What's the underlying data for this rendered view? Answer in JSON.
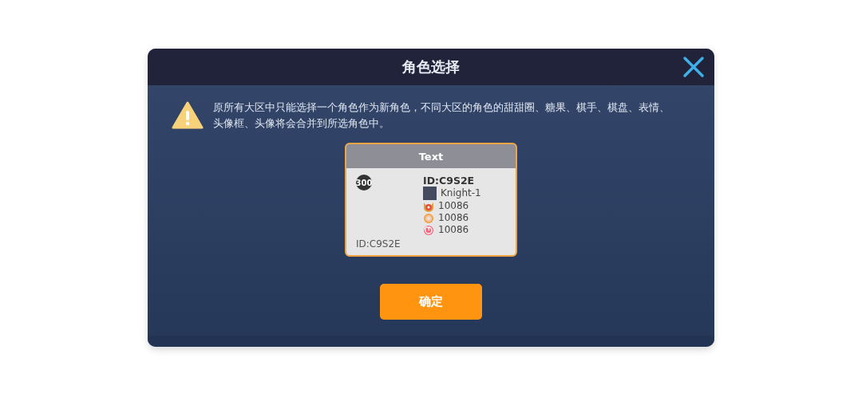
{
  "dialog": {
    "title": "角色选择"
  },
  "notice": "原所有大区中只能选择一个角色作为新角色，不同大区的角色的甜甜圈、糖果、棋手、棋盘、表情、头像框、头像将会合并到所选角色中。",
  "card": {
    "header": "Text",
    "level_badge": "300",
    "id_left": "ID:C9S2E",
    "id": "ID:C9S2E",
    "name": "Knight-1",
    "stats": [
      {
        "kind": "medal",
        "value": "10086"
      },
      {
        "kind": "donut",
        "value": "10086"
      },
      {
        "kind": "candy",
        "value": "10086"
      }
    ]
  },
  "confirm": "确定"
}
